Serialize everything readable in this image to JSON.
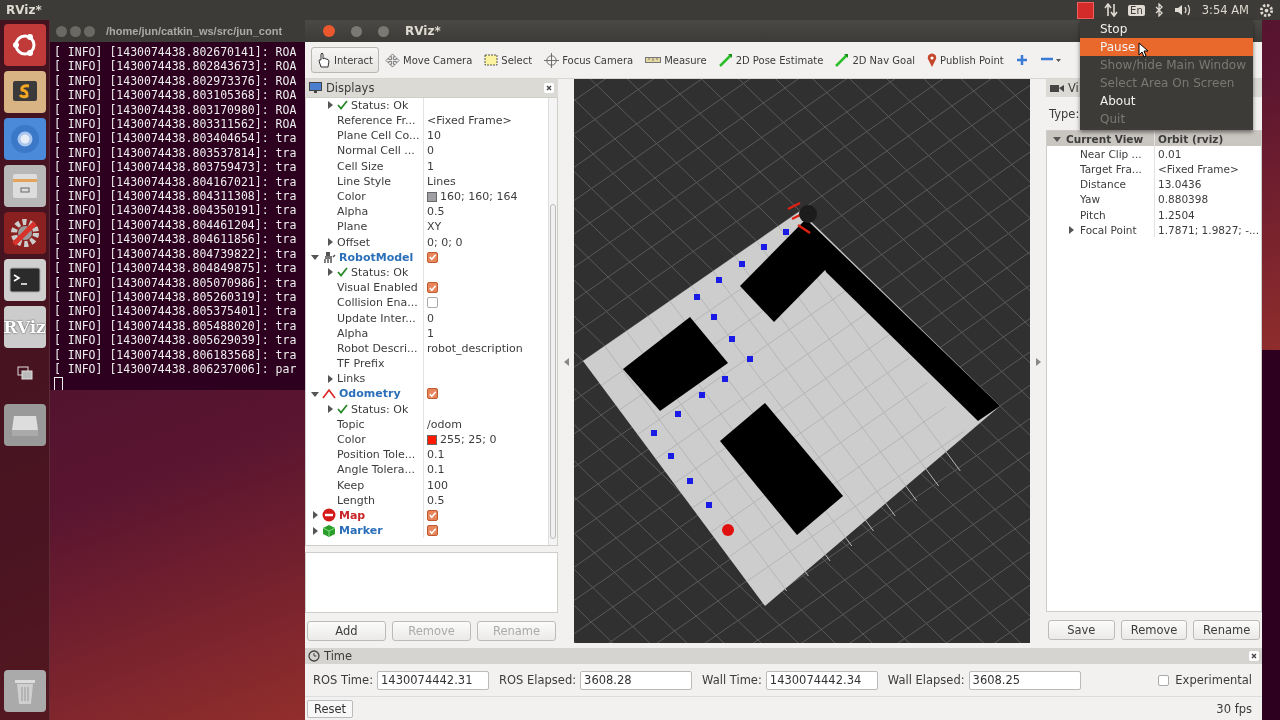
{
  "top_panel": {
    "title": "RViz*",
    "keyboard": "En",
    "clock": "3:54 AM"
  },
  "tray_menu": [
    {
      "label": "Stop",
      "selected": false,
      "disabled": false
    },
    {
      "label": "Pause",
      "selected": true,
      "disabled": false
    },
    {
      "label": "Show/hide Main Window",
      "selected": false,
      "disabled": true
    },
    {
      "label": "Select Area On Screen",
      "selected": false,
      "disabled": true
    },
    {
      "label": "About",
      "selected": false,
      "disabled": false
    },
    {
      "label": "Quit",
      "selected": false,
      "disabled": true
    }
  ],
  "launcher": [
    {
      "kind": "dash"
    },
    {
      "kind": "editor"
    },
    {
      "kind": "browser"
    },
    {
      "kind": "files"
    },
    {
      "kind": "settings"
    },
    {
      "kind": "terminal"
    },
    {
      "kind": "rviz",
      "label": "RViz"
    },
    {
      "kind": "workspaces"
    },
    {
      "kind": "drive"
    },
    {
      "kind": "trash"
    }
  ],
  "terminal": {
    "title": "/home/jun/catkin_ws/src/jun_cont",
    "lines": [
      "[ INFO] [1430074438.802670141]: ROA",
      "[ INFO] [1430074438.802843673]: ROA",
      "[ INFO] [1430074438.802973376]: ROA",
      "[ INFO] [1430074438.803105368]: ROA",
      "[ INFO] [1430074438.803170980]: ROA",
      "[ INFO] [1430074438.803311562]: ROA",
      "[ INFO] [1430074438.803404654]: tra",
      "[ INFO] [1430074438.803537814]: tra",
      "[ INFO] [1430074438.803759473]: tra",
      "[ INFO] [1430074438.804167021]: tra",
      "[ INFO] [1430074438.804311308]: tra",
      "[ INFO] [1430074438.804350191]: tra",
      "[ INFO] [1430074438.804461204]: tra",
      "[ INFO] [1430074438.804611856]: tra",
      "[ INFO] [1430074438.804739822]: tra",
      "[ INFO] [1430074438.804849875]: tra",
      "[ INFO] [1430074438.805070986]: tra",
      "[ INFO] [1430074438.805260319]: tra",
      "[ INFO] [1430074438.805375401]: tra",
      "[ INFO] [1430074438.805488020]: tra",
      "[ INFO] [1430074438.805629039]: tra",
      "[ INFO] [1430074438.806183568]: tra",
      "[ INFO] [1430074438.806237006]: par"
    ]
  },
  "rviz": {
    "title": "RViz*",
    "toolbar": [
      {
        "kind": "interact",
        "label": "Interact",
        "selected": true
      },
      {
        "kind": "move_camera",
        "label": "Move Camera",
        "selected": false
      },
      {
        "kind": "select",
        "label": "Select",
        "selected": false
      },
      {
        "kind": "focus_camera",
        "label": "Focus Camera",
        "selected": false
      },
      {
        "kind": "measure",
        "label": "Measure",
        "selected": false
      },
      {
        "kind": "pose",
        "label": "2D Pose Estimate",
        "selected": false
      },
      {
        "kind": "nav_goal",
        "label": "2D Nav Goal",
        "selected": false
      },
      {
        "kind": "publish_point",
        "label": "Publish Point",
        "selected": false
      },
      {
        "kind": "add_tool"
      },
      {
        "kind": "remove_tool"
      }
    ],
    "displays": {
      "title": "Displays",
      "tree": [
        {
          "children": [
            {
              "kind": "status",
              "name": "Status: Ok",
              "expanded": false
            },
            {
              "kind": "property",
              "name": "Reference Fr...",
              "value": "<Fixed Frame>"
            },
            {
              "kind": "property",
              "name": "Plane Cell Co...",
              "value": "10"
            },
            {
              "kind": "property",
              "name": "Normal Cell ...",
              "value": "0"
            },
            {
              "kind": "property",
              "name": "Cell Size",
              "value": "1"
            },
            {
              "kind": "property",
              "name": "Line Style",
              "value": "Lines"
            },
            {
              "kind": "color",
              "name": "Color",
              "value": "160; 160; 164",
              "color": "#a0a0a4"
            },
            {
              "kind": "property",
              "name": "Alpha",
              "value": "0.5"
            },
            {
              "kind": "property",
              "name": "Plane",
              "value": "XY"
            },
            {
              "kind": "property",
              "name": "Offset",
              "value": "0; 0; 0",
              "expanded": false
            }
          ]
        },
        {
          "kind": "robot",
          "name": "RobotModel",
          "checked": true,
          "error": false,
          "expanded": true,
          "children": [
            {
              "kind": "status",
              "name": "Status: Ok",
              "expanded": false
            },
            {
              "kind": "checkbox",
              "name": "Visual Enabled",
              "checked": true
            },
            {
              "kind": "checkbox",
              "name": "Collision Ena...",
              "checked": false
            },
            {
              "kind": "property",
              "name": "Update Inter...",
              "value": "0"
            },
            {
              "kind": "property",
              "name": "Alpha",
              "value": "1"
            },
            {
              "kind": "property",
              "name": "Robot Descri...",
              "value": "robot_description"
            },
            {
              "kind": "property",
              "name": "TF Prefix"
            },
            {
              "kind": "property",
              "name": "Links",
              "expanded": false
            }
          ]
        },
        {
          "kind": "odometry",
          "name": "Odometry",
          "checked": true,
          "error": false,
          "expanded": true,
          "children": [
            {
              "kind": "status",
              "name": "Status: Ok",
              "expanded": false
            },
            {
              "kind": "property",
              "name": "Topic",
              "value": "/odom"
            },
            {
              "kind": "color",
              "name": "Color",
              "value": "255; 25; 0",
              "color": "#ff1900"
            },
            {
              "kind": "property",
              "name": "Position Tole...",
              "value": "0.1"
            },
            {
              "kind": "property",
              "name": "Angle Tolera...",
              "value": "0.1"
            },
            {
              "kind": "property",
              "name": "Keep",
              "value": "100"
            },
            {
              "kind": "property",
              "name": "Length",
              "value": "0.5"
            }
          ]
        },
        {
          "kind": "map",
          "name": "Map",
          "checked": true,
          "error": true,
          "expanded": false
        },
        {
          "kind": "marker",
          "name": "Marker",
          "checked": true,
          "error": false,
          "expanded": false
        }
      ],
      "buttons": [
        {
          "label": "Add",
          "disabled": false
        },
        {
          "label": "Remove",
          "disabled": true
        },
        {
          "label": "Rename",
          "disabled": true
        }
      ]
    },
    "views": {
      "title": "Vi",
      "type_label": "Type:",
      "current": {
        "name": "Current View",
        "value": "Orbit (rviz)",
        "expanded": true,
        "children": [
          {
            "name": "Near Clip ...",
            "value": "0.01"
          },
          {
            "name": "Target Fra...",
            "value": "<Fixed Frame>"
          },
          {
            "name": "Distance",
            "value": "13.0436"
          },
          {
            "name": "Yaw",
            "value": "0.880398"
          },
          {
            "name": "Pitch",
            "value": "1.2504"
          },
          {
            "name": "Focal Point",
            "value": "1.7871; 1.9827; -...",
            "expanded": false
          }
        ]
      },
      "buttons": [
        {
          "label": "Save",
          "disabled": false
        },
        {
          "label": "Remove",
          "disabled": false
        },
        {
          "label": "Rename",
          "disabled": false
        }
      ]
    },
    "time": {
      "title": "Time",
      "fields": [
        {
          "label": "ROS Time:",
          "value": "1430074442.31"
        },
        {
          "label": "ROS Elapsed:",
          "value": "3608.28"
        },
        {
          "label": "Wall Time:",
          "value": "1430074442.34"
        },
        {
          "label": "Wall Elapsed:",
          "value": "3608.25"
        }
      ],
      "experimental": {
        "label": "Experimental",
        "checked": false
      }
    },
    "status_bar": {
      "reset": "Reset",
      "fps": "30 fps"
    }
  }
}
